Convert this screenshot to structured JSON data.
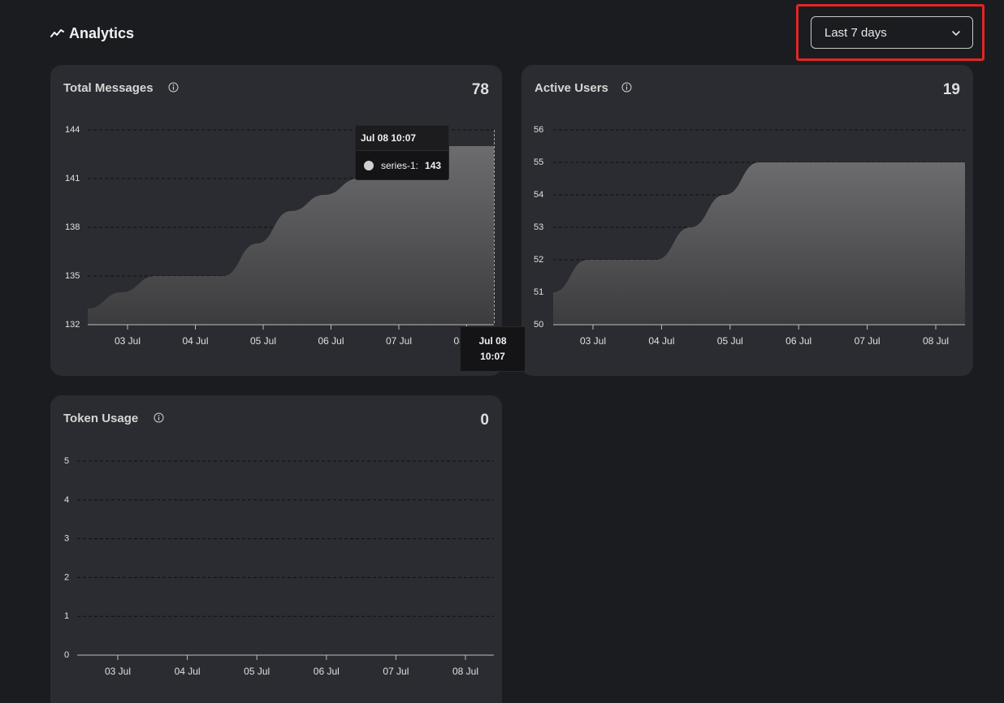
{
  "header": {
    "title": "Analytics",
    "icon": "trend-line-icon"
  },
  "range_select": {
    "selected": "Last 7 days",
    "icon": "chevron-down-icon"
  },
  "cards": {
    "messages": {
      "title": "Total Messages",
      "value": "78",
      "info_icon": "info-icon"
    },
    "users": {
      "title": "Active Users",
      "value": "19",
      "info_icon": "info-icon"
    },
    "tokens": {
      "title": "Token Usage",
      "value": "0",
      "info_icon": "info-icon"
    }
  },
  "tooltip": {
    "title": "Jul 08 10:07",
    "series_name": "series-1:",
    "value": "143",
    "x_label_line1": "Jul 08",
    "x_label_line2": "10:07"
  },
  "chart_data": [
    {
      "type": "area",
      "id": "messages",
      "x": [
        "02 Jul 12:00",
        "03 Jul",
        "03 Jul 12:00",
        "04 Jul",
        "04 Jul 12:00",
        "05 Jul",
        "05 Jul 12:00",
        "06 Jul",
        "06 Jul 12:00",
        "07 Jul",
        "07 Jul 12:00",
        "08 Jul",
        "08 Jul 10:07"
      ],
      "series": [
        {
          "name": "series-1",
          "values": [
            133,
            134,
            135,
            135,
            135,
            137,
            139,
            140,
            141,
            142,
            143,
            143,
            143
          ]
        }
      ],
      "x_ticks": [
        "03 Jul",
        "04 Jul",
        "05 Jul",
        "06 Jul",
        "07 Jul",
        "08 Jul"
      ],
      "y_ticks": [
        "144",
        "141",
        "138",
        "135",
        "132"
      ],
      "ylim": [
        132,
        144
      ],
      "grid": true
    },
    {
      "type": "area",
      "id": "users",
      "x": [
        "02 Jul 12:00",
        "03 Jul",
        "03 Jul 12:00",
        "04 Jul",
        "04 Jul 12:00",
        "05 Jul",
        "05 Jul 12:00",
        "06 Jul",
        "06 Jul 12:00",
        "07 Jul",
        "07 Jul 12:00",
        "08 Jul",
        "08 Jul 12:00"
      ],
      "series": [
        {
          "name": "series-1",
          "values": [
            51,
            52,
            52,
            52,
            53,
            54,
            55,
            55,
            55,
            55,
            55,
            55,
            55
          ]
        }
      ],
      "x_ticks": [
        "03 Jul",
        "04 Jul",
        "05 Jul",
        "06 Jul",
        "07 Jul",
        "08 Jul"
      ],
      "y_ticks": [
        "56",
        "55",
        "54",
        "53",
        "52",
        "51",
        "50"
      ],
      "ylim": [
        50,
        56
      ],
      "grid": true
    },
    {
      "type": "area",
      "id": "tokens",
      "x": [
        "03 Jul",
        "04 Jul",
        "05 Jul",
        "06 Jul",
        "07 Jul",
        "08 Jul"
      ],
      "series": [
        {
          "name": "series-1",
          "values": [
            0,
            0,
            0,
            0,
            0,
            0
          ]
        }
      ],
      "x_ticks": [
        "03 Jul",
        "04 Jul",
        "05 Jul",
        "06 Jul",
        "07 Jul",
        "08 Jul"
      ],
      "y_ticks": [
        "5",
        "4",
        "3",
        "2",
        "1",
        "0"
      ],
      "ylim": [
        0,
        5
      ],
      "grid": true
    }
  ]
}
